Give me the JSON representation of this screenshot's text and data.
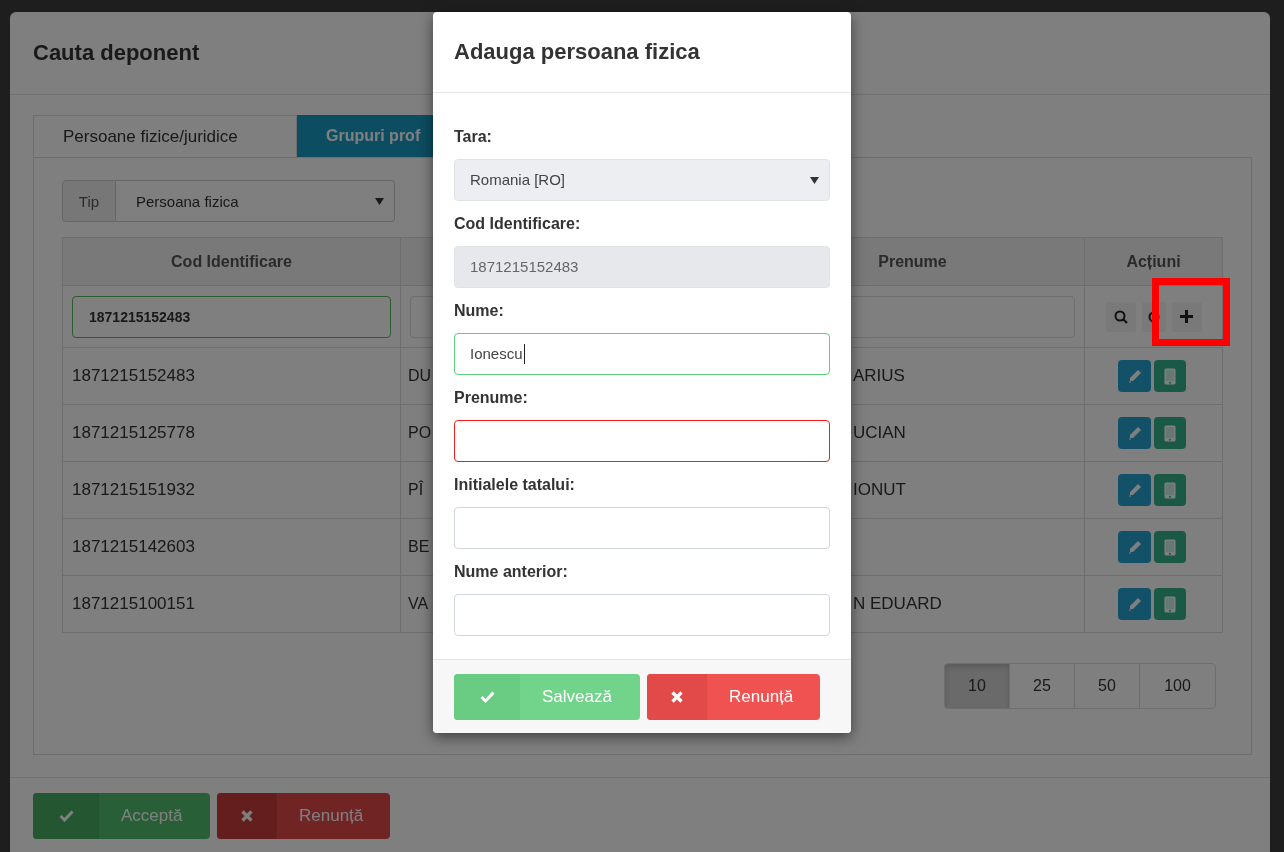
{
  "background_dialog": {
    "title": "Cauta deponent",
    "tabs": [
      {
        "label": "Persoane fizice/juridice",
        "selected": true
      },
      {
        "label": "Grupuri prof",
        "selected": false
      }
    ],
    "type_filter": {
      "label": "Tip",
      "value": "Persoana fizica"
    },
    "table": {
      "columns": [
        {
          "label": "Cod Identificare"
        },
        {},
        {
          "label": "Prenume"
        },
        {
          "label": "Acțiuni"
        }
      ],
      "filter_value": "1871215152483",
      "rows": [
        {
          "cod": "1871215152483",
          "column_2": "DU",
          "prenume": "ARIUS"
        },
        {
          "cod": "1871215125778",
          "column_2": "PO",
          "prenume": "UCIAN"
        },
        {
          "cod": "1871215151932",
          "column_2": "PÎ",
          "prenume": "IONUT"
        },
        {
          "cod": "1871215142603",
          "column_2": "BE"
        },
        {
          "cod": "1871215100151",
          "column_2": "VA",
          "prenume": "N EDUARD"
        }
      ]
    },
    "page_sizes": [
      {
        "label": "10",
        "selected": true
      },
      {
        "label": "25",
        "selected": false
      },
      {
        "label": "50",
        "selected": false
      },
      {
        "label": "100",
        "selected": false
      }
    ],
    "buttons": [
      {
        "label": "Acceptă",
        "kind": "accept"
      },
      {
        "label": "Renunță",
        "kind": "cancel"
      }
    ]
  },
  "modal": {
    "title": "Adauga persoana fizica",
    "fields": [
      {
        "label": "Tara:",
        "kind": "select",
        "value": "Romania [RO]",
        "disabled": false,
        "valid": false,
        "error": false,
        "focused": false
      },
      {
        "label": "Cod Identificare:",
        "kind": "text",
        "value": "1871215152483",
        "disabled": true,
        "valid": false,
        "error": false,
        "focused": false
      },
      {
        "label": "Nume:",
        "kind": "text",
        "value": "Ionescu",
        "disabled": false,
        "valid": true,
        "error": false,
        "focused": true
      },
      {
        "label": "Prenume:",
        "kind": "text",
        "disabled": false,
        "valid": false,
        "error": true,
        "focused": false
      },
      {
        "label": "Initialele tatalui:",
        "kind": "text",
        "disabled": false,
        "valid": false,
        "error": false,
        "focused": false
      },
      {
        "label": "Nume anterior:",
        "kind": "text",
        "disabled": false,
        "valid": false,
        "error": false,
        "focused": false
      }
    ],
    "buttons": [
      {
        "label": "Salvează",
        "kind": "accept"
      },
      {
        "label": "Renunță",
        "kind": "cancel"
      }
    ]
  }
}
